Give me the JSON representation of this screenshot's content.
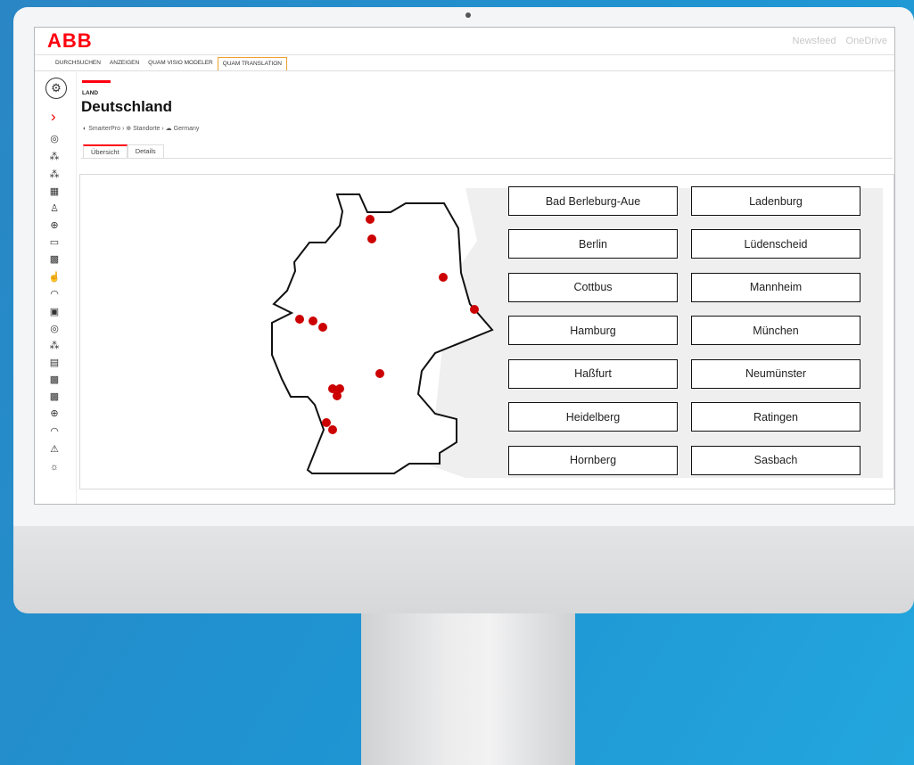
{
  "brand": {
    "logo": "ABB",
    "accent": "#FF000F",
    "tab_highlight": "#F0A030",
    "marker_color": "#CC0000"
  },
  "topbar": {
    "links": [
      "Newsfeed",
      "OneDrive"
    ]
  },
  "tabs": [
    "DURCHSUCHEN",
    "ANZEIGEN",
    "QUAM VISIO MODELER",
    "QUAM TRANSLATION"
  ],
  "active_tab": "QUAM TRANSLATION",
  "sidebar": {
    "icons": [
      "refresh-gear-icon",
      "chevron-right-icon",
      "target-icon",
      "hierarchy-icon",
      "hierarchy-icon",
      "building-icon",
      "person-icon",
      "globe-icon",
      "devices-icon",
      "cube-icon",
      "thumbs-up-icon",
      "gauge-icon",
      "image-icon",
      "target-icon",
      "hierarchy-icon",
      "document-icon",
      "cube-icon",
      "cube-icon",
      "globe-icon",
      "gauge-icon",
      "warning-icon",
      "bulb-icon"
    ]
  },
  "page": {
    "label": "LAND",
    "title": "Deutschland"
  },
  "breadcrumb": {
    "items": [
      "SmarterPro",
      "Standorte",
      "Germany"
    ],
    "separator": "›"
  },
  "subtabs": [
    "Übersicht",
    "Details"
  ],
  "active_subtab": "Übersicht",
  "cities": [
    "Bad Berleburg-Aue",
    "Ladenburg",
    "Berlin",
    "Lüdenscheid",
    "Cottbus",
    "Mannheim",
    "Hamburg",
    "München",
    "Haßfurt",
    "Neumünster",
    "Heidelberg",
    "Ratingen",
    "Hornberg",
    "Sasbach"
  ]
}
